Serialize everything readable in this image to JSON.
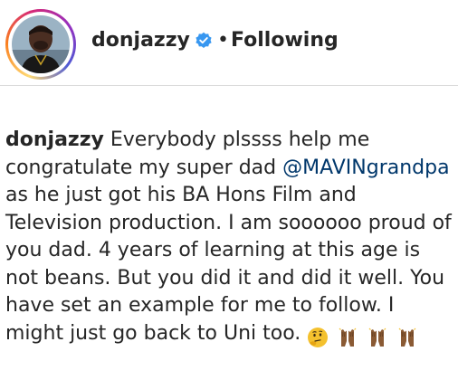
{
  "post_header": {
    "username": "donjazzy",
    "separator": "•",
    "follow_status": "Following"
  },
  "caption": {
    "username": "donjazzy",
    "text_part1": "Everybody plssss help me congratulate my super dad",
    "mention": "@MAVINgrandpa",
    "text_part2": "as he just got his BA Hons Film and Television production. I am soooooo proud of you dad. 4 years of learning at this age is not beans. But you did it and did it well. You have set an example for me to follow. I might just go back to Uni too."
  },
  "icons": {
    "verified": "verified-badge-icon",
    "emojis": [
      "thinking-face-emoji",
      "raising-hands-emoji",
      "raising-hands-emoji",
      "raising-hands-emoji"
    ]
  },
  "colors": {
    "verified_blue": "#3897f0",
    "mention": "#00376b",
    "text": "#262626"
  }
}
